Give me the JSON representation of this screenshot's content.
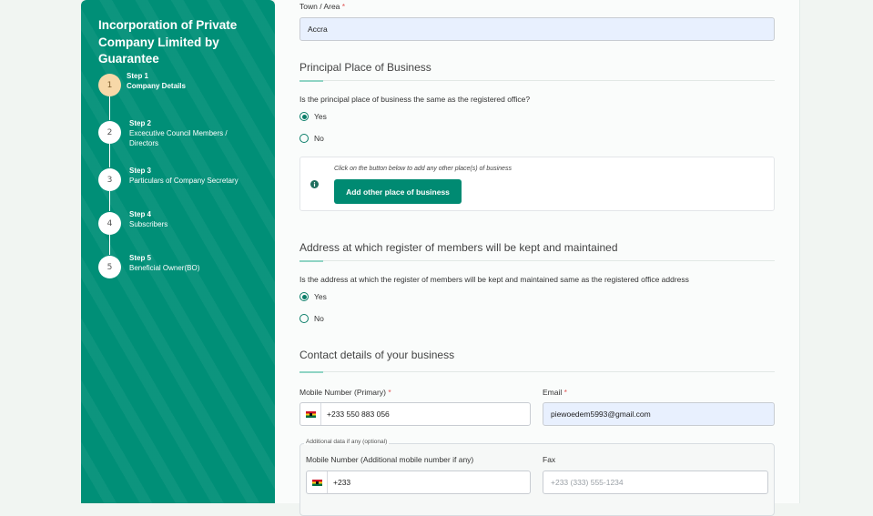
{
  "sidebar": {
    "title": "Incorporation of Private Company Limited by Guarantee",
    "steps": [
      {
        "number": "1",
        "step": "Step 1",
        "label": "Company Details"
      },
      {
        "number": "2",
        "step": "Step 2",
        "label": "Excecutive Council Members / Directors"
      },
      {
        "number": "3",
        "step": "Step 3",
        "label": "Particulars of Company Secretary"
      },
      {
        "number": "4",
        "step": "Step 4",
        "label": "Subscribers"
      },
      {
        "number": "5",
        "step": "Step 5",
        "label": "Beneficial Owner(BO)"
      }
    ]
  },
  "town": {
    "label": "Town / Area",
    "required": "*",
    "value": "Accra"
  },
  "principal": {
    "title": "Principal Place of Business",
    "question": "Is the principal place of business the same as the registered office?",
    "options": [
      "Yes",
      "No"
    ],
    "selected": "Yes",
    "hint": "Click on the button below to add any other place(s) of business",
    "button": "Add other place of business"
  },
  "register": {
    "title": "Address at which register of members will be kept and maintained",
    "question": "Is the address at which the register of members will be kept and maintained same as the registered office address",
    "options": [
      "Yes",
      "No"
    ],
    "selected": "Yes"
  },
  "contact": {
    "title": "Contact details of your business",
    "mobile_label": "Mobile Number (Primary)",
    "mobile_value": "+233 550 883 056",
    "email_label": "Email",
    "email_value": "piewoedem5993@gmail.com",
    "required": "*",
    "additional_legend": "Additional data if any (optional)",
    "additional_mobile_label": "Mobile Number (Additional mobile number if any)",
    "additional_mobile_value": "+233",
    "fax_label": "Fax",
    "fax_placeholder": "+233 (333) 555-1234"
  },
  "colors": {
    "sidebar": "#008f77",
    "accent": "#008a72",
    "active_step": "#f7d8a8"
  }
}
